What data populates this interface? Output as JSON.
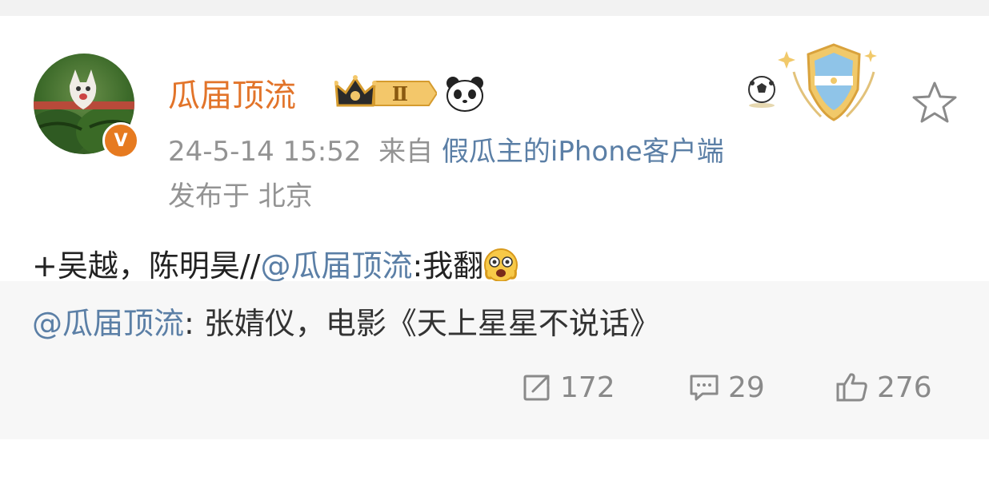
{
  "post": {
    "author": {
      "name": "瓜届顶流",
      "badge_level": "Ⅱ",
      "verified_mark": "V"
    },
    "meta": {
      "timestamp": "24-5-14 15:52",
      "from_label": "来自",
      "source": "假瓜主的iPhone客户端",
      "location": "发布于 北京"
    },
    "content": {
      "prefix": "+吴越，陈明昊//",
      "mention": "@瓜届顶流",
      "suffix": ":我翻"
    },
    "repost": {
      "mention": "@瓜届顶流",
      "text": ": 张婧仪，电影《天上星星不说话》"
    },
    "actions": {
      "reposts": "172",
      "comments": "29",
      "likes": "276"
    }
  },
  "icons": [
    "crown-badge-icon",
    "panda-icon",
    "soccer-ball-icon",
    "argentina-shield-icon",
    "star-icon",
    "shock-emoji-icon",
    "repost-icon",
    "comment-icon",
    "like-icon"
  ],
  "colors": {
    "username": "#e2742a",
    "link": "#5b7fa6",
    "meta": "#939393",
    "repost_bg": "#f7f7f7"
  }
}
